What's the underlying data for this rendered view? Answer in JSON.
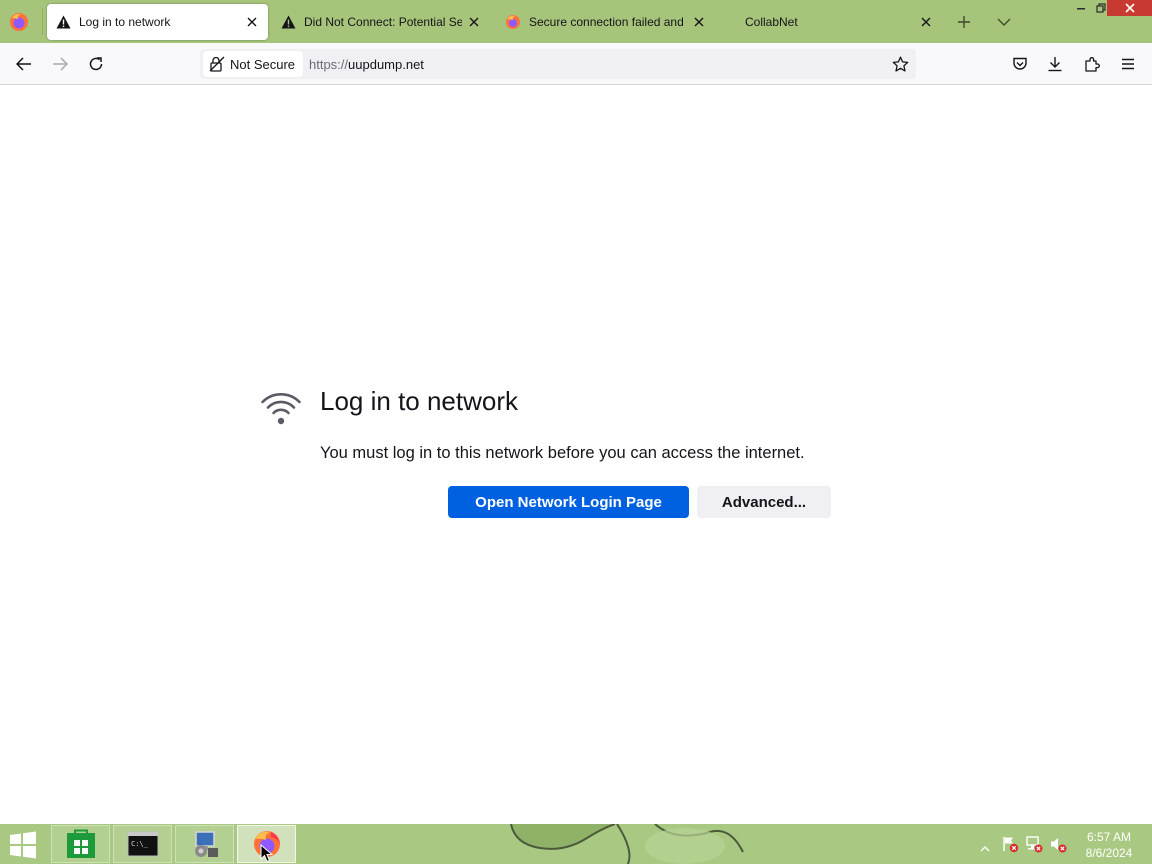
{
  "browser": {
    "tabs": [
      {
        "title": "Log in to network",
        "icon": "warning-icon",
        "active": true
      },
      {
        "title": "Did Not Connect: Potential Securit",
        "icon": "warning-icon",
        "active": false
      },
      {
        "title": "Secure connection failed and Firef",
        "icon": "firefox-icon",
        "active": false
      },
      {
        "title": "CollabNet",
        "icon": "none",
        "active": false
      }
    ],
    "security_label": "Not Secure",
    "url_scheme": "https://",
    "url_host": "uupdump.net"
  },
  "page": {
    "title": "Log in to network",
    "description": "You must log in to this network before you can access the internet.",
    "primary_button": "Open Network Login Page",
    "secondary_button": "Advanced..."
  },
  "taskbar": {
    "apps": [
      "store-icon",
      "cmd-icon",
      "network-admin-icon",
      "firefox-icon"
    ],
    "time": "6:57 AM",
    "date": "8/6/2024"
  },
  "colors": {
    "accent": "#0061e0",
    "tabbar": "#a6c57a",
    "taskbar": "#a9c983"
  }
}
